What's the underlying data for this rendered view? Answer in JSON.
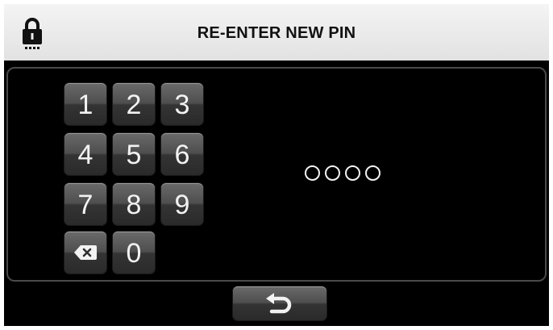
{
  "header": {
    "title": "RE-ENTER NEW PIN",
    "icon": "lock-icon"
  },
  "keypad": {
    "keys": [
      "1",
      "2",
      "3",
      "4",
      "5",
      "6",
      "7",
      "8",
      "9",
      "0"
    ],
    "backspace_icon": "backspace-icon"
  },
  "pin": {
    "length": 4,
    "entered": 0,
    "placeholder": "OOOO"
  },
  "footer": {
    "back_icon": "back-arrow-icon"
  },
  "colors": {
    "header_bg": "#ececec",
    "screen_bg": "#000000",
    "key_bg": "#4e4e4e",
    "text_light": "#f2f2f2",
    "text_dark": "#111111"
  }
}
